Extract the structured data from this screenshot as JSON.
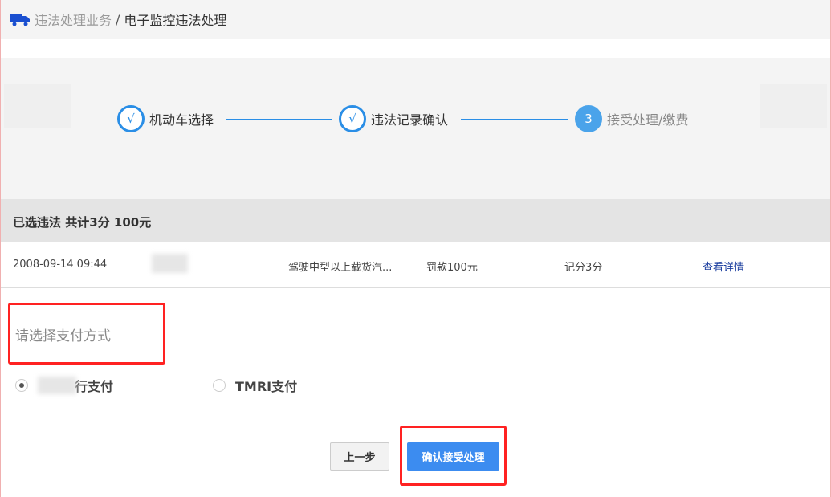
{
  "breadcrumb": {
    "icon": "truck-icon",
    "parent": "违法处理业务",
    "separator": "/",
    "current": "电子监控违法处理"
  },
  "steps": [
    {
      "mark": "√",
      "label": "机动车选择"
    },
    {
      "mark": "√",
      "label": "违法记录确认"
    },
    {
      "mark": "3",
      "label": "接受处理/缴费"
    }
  ],
  "summary": "已选违法 共计3分 100元",
  "violation": {
    "time": "2008-09-14 09:44",
    "desc": "驾驶中型以上载货汽...",
    "fine": "罚款100元",
    "points": "记分3分",
    "link": "查看详情"
  },
  "payment": {
    "title": "请选择支付方式",
    "options": [
      {
        "label": "行支付",
        "selected": true
      },
      {
        "label": "TMRI支付",
        "selected": false
      }
    ]
  },
  "buttons": {
    "prev": "上一步",
    "confirm": "确认接受处理"
  },
  "colors": {
    "accent": "#2a8ee6",
    "primary_button": "#3c8cf0",
    "highlight": "#ff2222"
  }
}
